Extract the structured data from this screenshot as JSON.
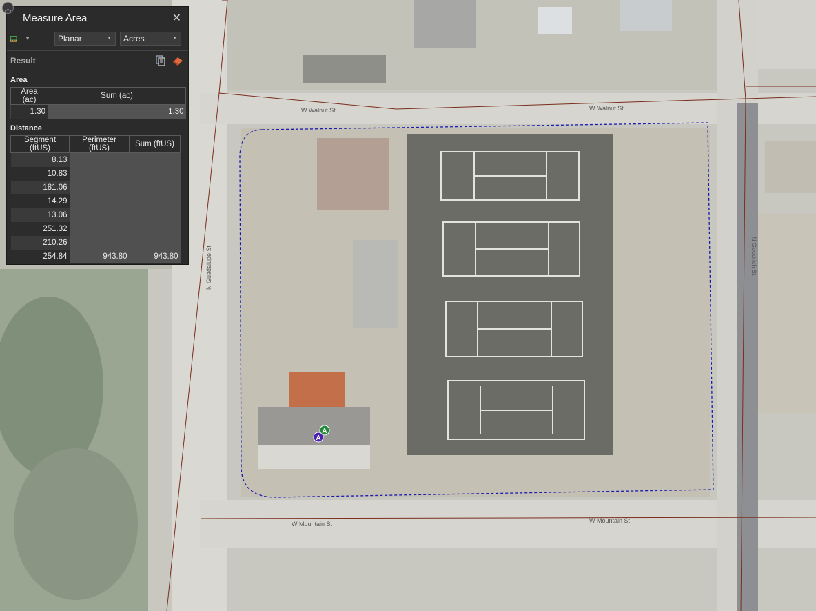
{
  "panel": {
    "title": "Measure Area",
    "close_glyph": "✕",
    "mode_select": "Planar",
    "unit_select": "Acres",
    "result_label": "Result",
    "tool_icon": "measure-area-icon",
    "copy_icon": "copy-icon",
    "clear_icon": "eraser-icon"
  },
  "area": {
    "label": "Area",
    "headers": [
      "Area (ac)",
      "Sum (ac)"
    ],
    "value": "1.30",
    "sum": "1.30"
  },
  "distance": {
    "label": "Distance",
    "headers": [
      "Segment (ftUS)",
      "Perimeter (ftUS)",
      "Sum (ftUS)"
    ],
    "segments": [
      "8.13",
      "10.83",
      "181.06",
      "14.29",
      "13.06",
      "251.32",
      "210.26",
      "254.84"
    ],
    "perimeter": "943.80",
    "sum": "943.80"
  },
  "map": {
    "roads": {
      "walnut_left": "W Walnut St",
      "walnut_right": "W Walnut St",
      "mountain_left": "W Mountain St",
      "mountain_right": "W Mountain St",
      "guadalupe": "N Guadalupe St",
      "goodrich": "N Goodrich St"
    },
    "marker_green": "A",
    "marker_purple": "A",
    "colors": {
      "measure_outline": "#1a1ab0",
      "parcel_lines": "#7a2e1c",
      "marker_green": "#1f8a3a",
      "marker_purple": "#4b1fb0"
    }
  }
}
